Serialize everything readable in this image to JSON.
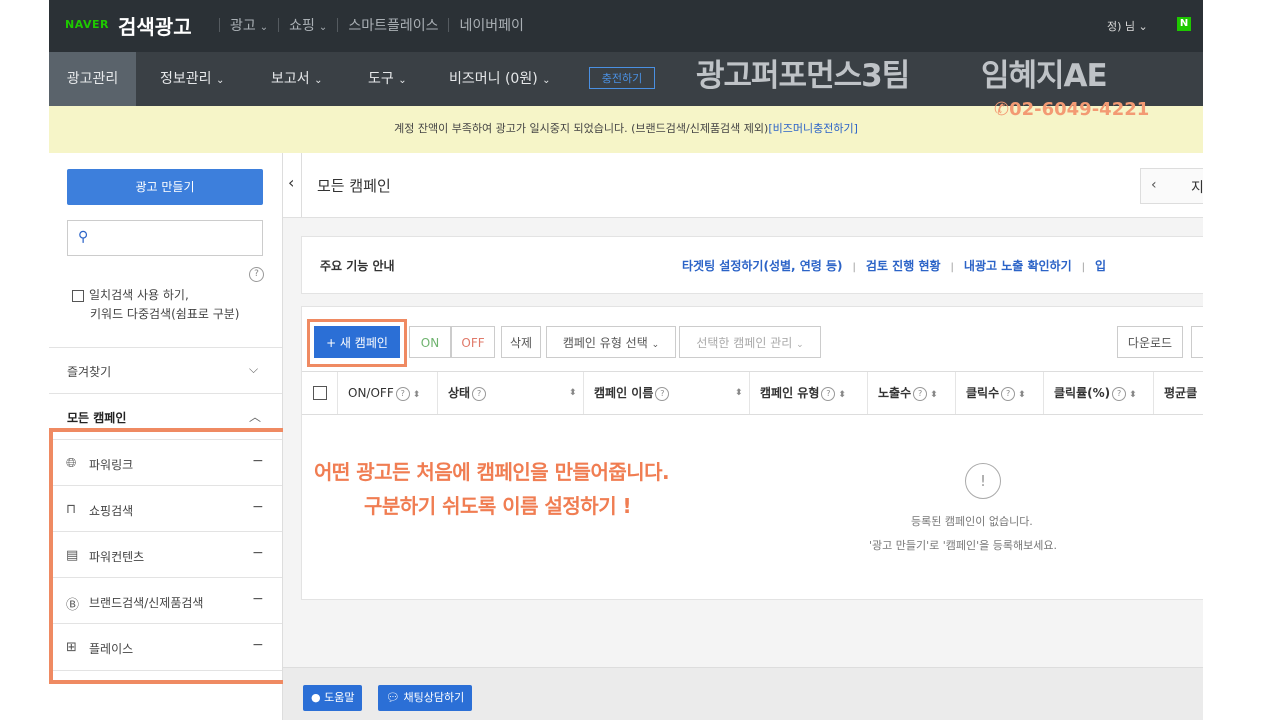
{
  "topbar": {
    "naver": "NAVER",
    "product": "검색광고",
    "menus": [
      {
        "label": "광고",
        "caret": true
      },
      {
        "label": "쇼핑",
        "caret": true
      },
      {
        "label": "스마트플레이스",
        "caret": false
      },
      {
        "label": "네이버페이",
        "caret": false
      }
    ],
    "user": "정) 님",
    "n_badge": "N"
  },
  "subnav": {
    "items": [
      "광고관리",
      "정보관리",
      "보고서",
      "도구",
      "비즈머니 (0원)"
    ],
    "charge_button": "충전하기"
  },
  "overlay": {
    "team_title": "광고퍼포먼스3팀",
    "name": "임혜지AE",
    "phone": "02-6049-4221"
  },
  "notice": {
    "text": "계정 잔액이 부족하여 광고가 일시중지 되었습니다. (브랜드검색/신제품검색 제외)",
    "link": "[비즈머니충전하기]"
  },
  "sidebar": {
    "make_ad_button": "광고 만들기",
    "search_placeholder": "",
    "exact_search_line1": "일치검색 사용 하기,",
    "exact_search_line2": "키워드 다중검색(쉼표로 구분)",
    "favorites": "즐겨찾기",
    "all_campaigns": "모든 캠페인",
    "campaign_types": [
      {
        "label": "파워링크",
        "icon": "globe-icon"
      },
      {
        "label": "쇼핑검색",
        "icon": "shopping-bag-icon"
      },
      {
        "label": "파워컨텐츠",
        "icon": "content-icon"
      },
      {
        "label": "브랜드검색/신제품검색",
        "icon": "brand-b-icon"
      },
      {
        "label": "플레이스",
        "icon": "place-map-icon"
      }
    ]
  },
  "main": {
    "title": "모든 캠페인",
    "pager_next": "지",
    "feature_guide": {
      "title": "주요 기능 안내",
      "links": [
        "타겟팅 설정하기(성별, 연령 등)",
        "검토 진행 현황",
        "내광고 노출 확인하기",
        "입"
      ]
    },
    "toolbar": {
      "new_campaign": "+ 새 캠페인",
      "on": "ON",
      "off": "OFF",
      "delete": "삭제",
      "type_select": "캠페인 유형 선택",
      "manage_select": "선택한 캠페인 관리",
      "download": "다운로드"
    },
    "columns": [
      "ON/OFF",
      "상태",
      "캠페인 이름",
      "캠페인 유형",
      "노출수",
      "클릭수",
      "클릭률(%)",
      "평균클"
    ],
    "empty": {
      "line1": "등록된 캠페인이 없습니다.",
      "line2": "'광고 만들기'로 '캠페인'을 등록해보세요."
    },
    "annotation_line1": "어떤 광고든 처음에 캠페인을 만들어줍니다.",
    "annotation_line2": "구분하기 쉬도록 이름 설정하기 !"
  },
  "footer": {
    "help": "도움말",
    "chat": "채팅상담하기"
  },
  "colors": {
    "accent": "#2b6fd6",
    "highlight": "#ef8a62",
    "naver_green": "#1ec800"
  }
}
